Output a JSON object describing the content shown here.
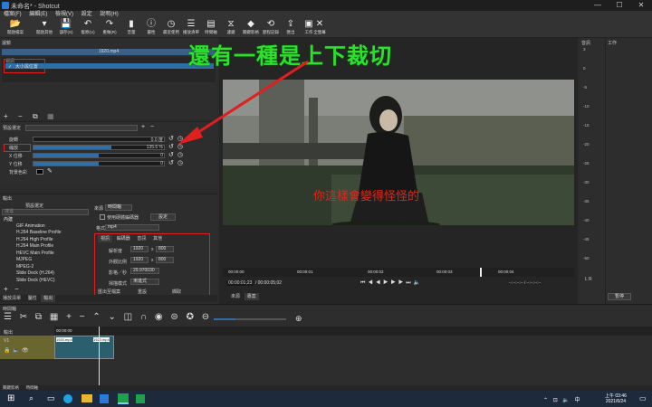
{
  "titlebar": {
    "title": "未命名* - Shotcut",
    "minimize": "—",
    "maximize": "☐",
    "close": "✕"
  },
  "menubar": [
    "檔案(F)",
    "編輯(E)",
    "檢視(V)",
    "設定",
    "說明(H)"
  ],
  "toolbar": [
    {
      "icon": "folder-open-icon",
      "glyph": "📂",
      "label": "開啟檔案"
    },
    {
      "icon": "open-other-icon",
      "glyph": "▾",
      "label": "開啟其他"
    },
    {
      "icon": "save-icon",
      "glyph": "💾",
      "label": "儲存(S)"
    },
    {
      "icon": "undo-icon",
      "glyph": "↶",
      "label": "復原(U)"
    },
    {
      "icon": "redo-icon",
      "glyph": "↷",
      "label": "重做(R)"
    },
    {
      "icon": "peak-meter-icon",
      "glyph": "▮",
      "label": "音量"
    },
    {
      "icon": "properties-icon",
      "glyph": "ⓘ",
      "label": "屬性"
    },
    {
      "icon": "recent-icon",
      "glyph": "◷",
      "label": "最近使用"
    },
    {
      "icon": "playlist-icon",
      "glyph": "☰",
      "label": "播放清單"
    },
    {
      "icon": "timeline-icon",
      "glyph": "▤",
      "label": "時間軸"
    },
    {
      "icon": "filters-icon",
      "glyph": "⧖",
      "label": "濾鏡"
    },
    {
      "icon": "keyframes-icon",
      "glyph": "◆",
      "label": "關鍵影格"
    },
    {
      "icon": "history-icon",
      "glyph": "⟲",
      "label": "歷程記錄"
    },
    {
      "icon": "export-icon",
      "glyph": "⇪",
      "label": "匯出"
    },
    {
      "icon": "jobs-icon",
      "glyph": "▣",
      "label": "工作"
    },
    {
      "icon": "fullscreen-icon",
      "glyph": "✕",
      "label": "全螢幕"
    }
  ],
  "filters": {
    "header": "濾鏡",
    "clip_name": "1920.mp4",
    "section_label": "視訊",
    "item_label": "大小與位置"
  },
  "filter_settings": {
    "preset_label": "預設選定",
    "rows": [
      {
        "label": "旋轉",
        "value": "0.0 度",
        "level": 0
      },
      {
        "label": "縮放",
        "value": "135.6 %",
        "level": 0.6
      },
      {
        "label": "X 位移",
        "value": "0",
        "level": 0.5
      },
      {
        "label": "Y 位移",
        "value": "0",
        "level": 0.5
      },
      {
        "label": "背景色彩",
        "value": "",
        "level": 0
      }
    ]
  },
  "export": {
    "header": "輸出",
    "presets_header": "預設選定",
    "search_placeholder": "搜尋",
    "tree": [
      "內建",
      "GIF Animation",
      "H.264 Baseline Profile",
      "H.264 High Profile",
      "H.264 Main Profile",
      "HEVC Main Profile",
      "MJPEG",
      "MPEG-2",
      "Slide Deck (H.264)",
      "Slide Deck (HEVC)"
    ],
    "source_label": "來源",
    "source_value": "時間軸",
    "hw_label": "使用硬體編碼器",
    "config_button": "設定",
    "format_label": "格式",
    "format_value": "mp4",
    "tabs": [
      "視訊",
      "編碼器",
      "音訊",
      "其他"
    ],
    "resolution_label": "解析度",
    "res_w": "1920",
    "res_h": "800",
    "x_label": "x",
    "aspect_label": "外觀比例",
    "aspect_w": "1920",
    "aspect_h": "800",
    "fps_label": "影格／秒",
    "fps_value": "29.970030",
    "scan_label": "掃描模式",
    "scan_value": "漸進式",
    "export_file_button": "匯出至檔案",
    "reset_button": "重設",
    "stop_button": "擷取"
  },
  "left_tabs": [
    "播放清單",
    "屬性",
    "輸出"
  ],
  "overlay_title": "還有一種是上下裁切",
  "subtitle": "你這樣會變得怪怪的",
  "player": {
    "ticks": [
      "00:00:00",
      "00:00:01",
      "00:00:02",
      "00:00:03",
      "00:00:04"
    ],
    "position": "00:00:01;23",
    "duration": "/ 00:00:05;02",
    "in_point": "--:--:--:--",
    "out_point": "--:--:--:--",
    "tabs": [
      "來源",
      "專案"
    ]
  },
  "audio": {
    "header": "音訊",
    "scale": [
      "3",
      "0",
      "-5",
      "-10",
      "-15",
      "-20",
      "-25",
      "-30",
      "-35",
      "-40",
      "-45",
      "-50"
    ],
    "lr": "L R"
  },
  "jobs": {
    "header": "工作",
    "pause_button": "暫停"
  },
  "timeline": {
    "header": "時間軸",
    "track_name": "V1",
    "output_label": "輸出",
    "clip_start": "00:00:00",
    "clip1": "1920.mp4",
    "clip2": "1920.mp4"
  },
  "bottom_tabs": [
    "關鍵影格",
    "時間軸"
  ],
  "taskbar": {
    "time": "上午 03:46",
    "date": "2021/6/24"
  }
}
